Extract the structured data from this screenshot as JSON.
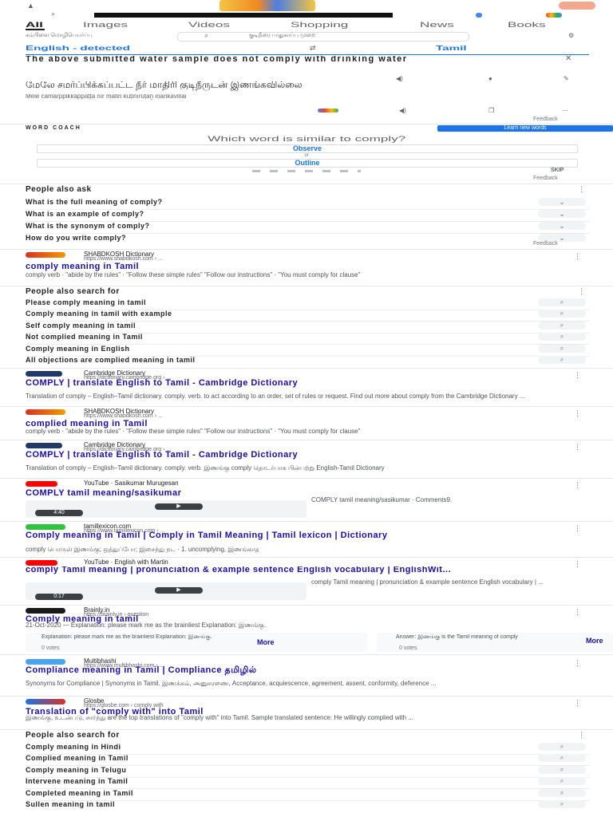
{
  "tabs": [
    "All",
    "Images",
    "Videos",
    "Shopping",
    "News",
    "Books"
  ],
  "search": {
    "query": "கம்பிளை மொழிபெயர்ப்பு",
    "filters": "குடிநீரை பாதுகாப்பு முறை",
    "placeholder": ""
  },
  "translate": {
    "src_lang": "English - detected",
    "tgt_lang": "Tamil",
    "source_text": "The above submitted water sample does not comply with drinking water",
    "result_text": "மேலே சமர்ப்பிக்கப்பட்ட நீர் மாதிரி குடிநீருடன் இணங்கவில்லை",
    "transliteration": "Mēlē camarppikkappaṭṭa nīr mātiri kuṭinīruṭaṉ iṇaṅkavillai",
    "feedback": "Feedback"
  },
  "word_coach": {
    "label": "WORD COACH",
    "learn_button": "Learn new words",
    "question": "Which word is similar to comply?",
    "option1": "Observe",
    "or": "or",
    "option2": "Outline",
    "skip": "SKIP",
    "feedback": "Feedback"
  },
  "paa": {
    "title": "People also ask",
    "questions": [
      "What is the full meaning of comply?",
      "What is an example of comply?",
      "What is the synonym of comply?",
      "How do you write comply?"
    ],
    "feedback": "Feedback"
  },
  "results1": [
    {
      "source": "SHABDKOSH Dictionary",
      "url": "https://www.shabdkosh.com › ...",
      "title": "comply meaning in Tamil",
      "snippet": "comply verb · \"abide by the rules\" · \"Follow these simple rules\" \"Follow our instructions\" · \"You must comply for clause\""
    }
  ],
  "related1": {
    "title": "People also search for",
    "items": [
      "Please comply meaning in tamil",
      "Comply meaning in tamil with example",
      "Self comply meaning in tamil",
      "Not complied meaning in Tamil",
      "Comply meaning in English",
      "All objections are complied meaning in tamil"
    ]
  },
  "results2": [
    {
      "source": "Cambridge Dictionary",
      "url": "https://dictionary.cambridge.org › ...",
      "title": "COMPLY | translate English to Tamil - Cambridge Dictionary",
      "snippet": "Translation of comply – English–Tamil dictionary. comply. verb. to act according to an order, set of rules or request. Find out more about comply from the Cambridge Dictionary ..."
    },
    {
      "source": "SHABDKOSH Dictionary",
      "url": "https://www.shabdkosh.com › ...",
      "title": "complied meaning in Tamil",
      "snippet": "comply verb · \"abide by the rules\" · \"Follow these simple rules\" \"Follow our instructions\" · \"You must comply for clause\""
    },
    {
      "source": "Cambridge Dictionary",
      "url": "https://dictionary.cambridge.org › ...",
      "title": "COMPLY | translate English to Tamil - Cambridge Dictionary",
      "snippet": "Translation of comply – English–Tamil dictionary. comply. verb. இணங்கு comply தொடர்பாக பின்பற்று English-Tamil Dictionary"
    }
  ],
  "video1": {
    "source": "YouTube · Sasikumar Murugesan",
    "url": "",
    "title": "COMPLY tamil meaning/sasikumar",
    "duration": "4:40",
    "caption": "COMPLY tamil meaning/sasikumar · Comments9."
  },
  "result_tamillex": {
    "source": "tamillexicon.com",
    "url": "https://www.tamillexicon.com › ...",
    "title": "Comply meaning in Tamil | Comply in Tamil Meaning | Tamil lexicon | Dictionary",
    "snippet": "comply பொருள் இணங்கு; ஒத்துப்போ; இசைந்து நட · 1. uncomplying, இணங்காத"
  },
  "video2": {
    "source": "YouTube · English with Martin",
    "url": "",
    "title": "comply Tamil meaning | pronunciation & example sentence English vocabulary | EnglishWit...",
    "duration": "0:17",
    "caption": "comply Tamil meaning | pronunciation & example sentence English vocabulary | ..."
  },
  "brainly": {
    "source": "Brainly.in",
    "url": "https://brainly.in › question",
    "title": "Comply meaning in tamil",
    "snippet": "21-Oct-2020 — Explanation: please mark me as the brainliest Explanation: இணங்கு.",
    "card1": "Explanation: please mark me as the brainliest Explanation: இணங்கு.",
    "card1_more": "More",
    "card1_votes": "0 votes",
    "card2": "Answer: இணங்கு is the Tamil meaning of comply",
    "card2_more": "More",
    "card2_votes": "0 votes"
  },
  "results3": [
    {
      "source": "Multibhashi",
      "url": "https://www.multibhashi.com › ...",
      "title": "Compliance meaning in Tamil | Compliance தமிழில்",
      "snippet": "Synonyms for Compliance | Synonyms in Tamil. இணக்கம், அனுசரணை, Acceptance, acquiescence, agreement, assent, conformity, deference ..."
    },
    {
      "source": "Glosbe",
      "url": "https://glosbe.com › comply with",
      "title": "Translation of \"comply with\" into Tamil",
      "snippet": "இணங்கு, உடன்படு, சார்ந்து are the top translations of \"comply with\" into Tamil. Sample translated sentence: He willingly complied with ..."
    }
  ],
  "related2": {
    "title": "People also search for",
    "items": [
      "Comply meaning in Hindi",
      "Complied meaning in Tamil",
      "Comply meaning in Telugu",
      "Intervene meaning in Tamil",
      "Completed meaning in Tamil",
      "Sullen meaning in tamil"
    ]
  }
}
